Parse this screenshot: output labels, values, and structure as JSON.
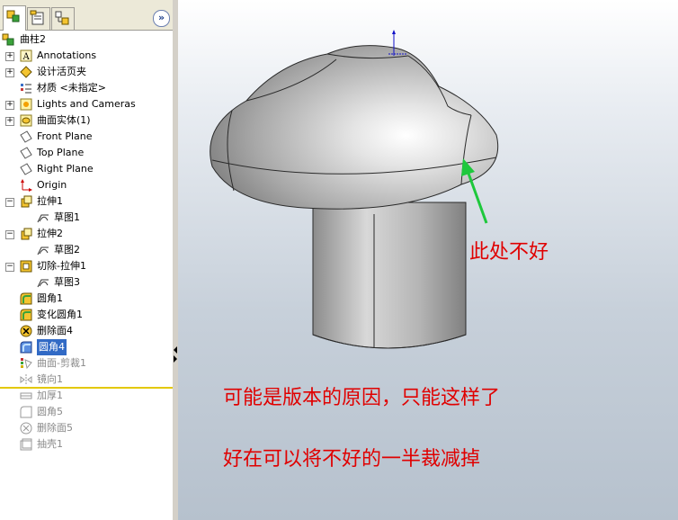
{
  "tree": {
    "root": "曲柱2",
    "items": [
      {
        "label": "Annotations",
        "icon": "annotations-icon"
      },
      {
        "label": "设计活页夹",
        "icon": "design-binder-icon"
      },
      {
        "label": "材质 <未指定>",
        "icon": "material-icon"
      },
      {
        "label": "Lights and Cameras",
        "icon": "lights-cameras-icon"
      },
      {
        "label": "曲面实体(1)",
        "icon": "surface-bodies-icon"
      },
      {
        "label": "Front Plane",
        "icon": "plane-icon"
      },
      {
        "label": "Top Plane",
        "icon": "plane-icon"
      },
      {
        "label": "Right Plane",
        "icon": "plane-icon"
      },
      {
        "label": "Origin",
        "icon": "origin-icon"
      },
      {
        "label": "拉伸1",
        "icon": "extrude-icon"
      },
      {
        "label": "草图1",
        "icon": "sketch-icon"
      },
      {
        "label": "拉伸2",
        "icon": "extrude-icon"
      },
      {
        "label": "草图2",
        "icon": "sketch-icon"
      },
      {
        "label": "切除-拉伸1",
        "icon": "cut-extrude-icon"
      },
      {
        "label": "草图3",
        "icon": "sketch-icon"
      },
      {
        "label": "圆角1",
        "icon": "fillet-icon"
      },
      {
        "label": "变化圆角1",
        "icon": "variable-fillet-icon"
      },
      {
        "label": "删除面4",
        "icon": "delete-face-icon"
      },
      {
        "label": "圆角4",
        "icon": "fillet-icon"
      },
      {
        "label": "曲面-剪裁1",
        "icon": "surface-trim-icon"
      },
      {
        "label": "镜向1",
        "icon": "mirror-icon"
      },
      {
        "label": "加厚1",
        "icon": "thicken-icon"
      },
      {
        "label": "圆角5",
        "icon": "fillet-icon"
      },
      {
        "label": "删除面5",
        "icon": "delete-face-icon"
      },
      {
        "label": "抽壳1",
        "icon": "shell-icon"
      }
    ]
  },
  "annotations": {
    "arrow_note": "此处不好",
    "note1": "可能是版本的原因，只能这样了",
    "note2": "好在可以将不好的一半裁减掉"
  },
  "colors": {
    "annotation_text": "#e00000",
    "arrow": "#1ec83c",
    "selection": "#316ac5",
    "rollback_bar": "#e3c800"
  }
}
